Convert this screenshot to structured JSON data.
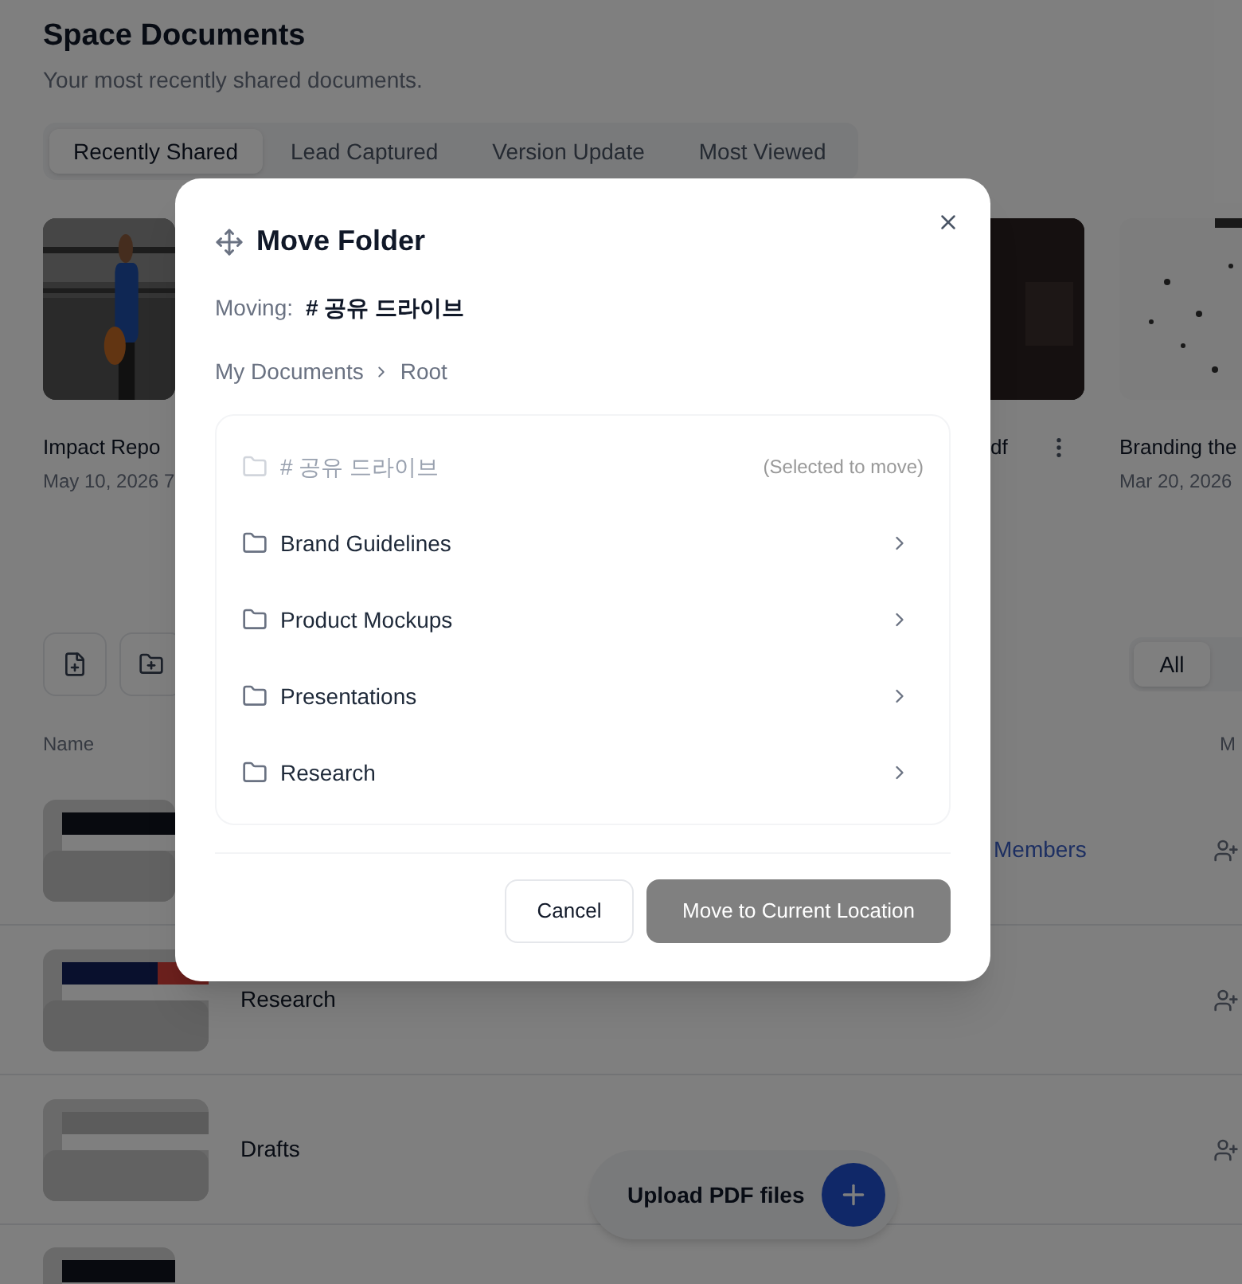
{
  "page": {
    "title": "Space Documents",
    "subtitle": "Your most recently shared documents."
  },
  "tabs": [
    {
      "label": "Recently Shared",
      "selected": true
    },
    {
      "label": "Lead Captured",
      "selected": false
    },
    {
      "label": "Version Update",
      "selected": false
    },
    {
      "label": "Most Viewed",
      "selected": false
    }
  ],
  "cards": [
    {
      "title": "Impact Repo",
      "date": "May 10, 2026 7"
    },
    {
      "kind": "dark",
      "title": "df",
      "has_menu": true
    },
    {
      "kind": "sketch",
      "title": "Branding the",
      "date": "Mar 20, 2026"
    }
  ],
  "toolbar": {
    "filter": "All"
  },
  "table": {
    "columns": [
      "Name",
      "M"
    ],
    "rows": [
      {
        "link": "Members"
      },
      {
        "name": "Research"
      },
      {
        "name": "Drafts"
      }
    ]
  },
  "upload": {
    "label": "Upload PDF files"
  },
  "dialog": {
    "title": "Move Folder",
    "moving_label": "Moving:",
    "moving_value": "# 공유 드라이브",
    "breadcrumb": [
      "My Documents",
      "Root"
    ],
    "folders": [
      {
        "name": "# 공유 드라이브",
        "disabled": true,
        "note": "(Selected to move)"
      },
      {
        "name": "Brand Guidelines",
        "disabled": false
      },
      {
        "name": "Product Mockups",
        "disabled": false
      },
      {
        "name": "Presentations",
        "disabled": false
      },
      {
        "name": "Research",
        "disabled": false
      }
    ],
    "cancel": "Cancel",
    "confirm": "Move to Current Location",
    "confirm_disabled": true
  }
}
